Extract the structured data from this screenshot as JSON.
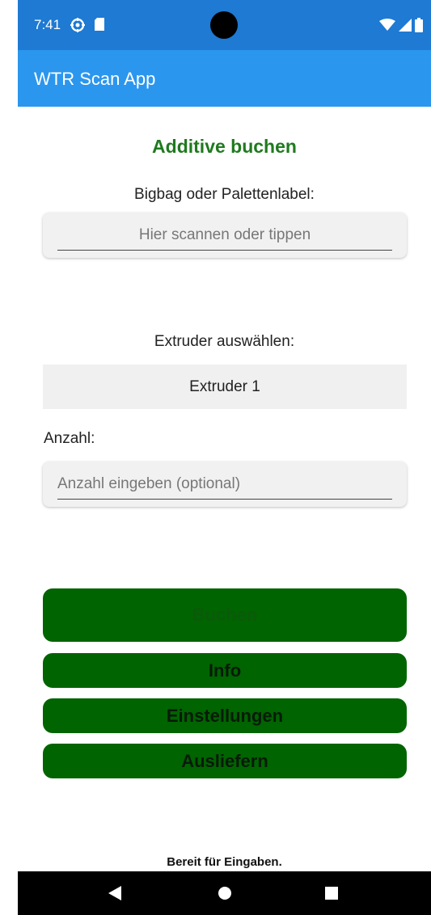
{
  "status_bar": {
    "time": "7:41",
    "left_icons": [
      "settings-icon",
      "sd-card-icon"
    ],
    "right_icons": [
      "wifi-icon",
      "signal-icon",
      "battery-icon"
    ]
  },
  "app_bar": {
    "title": "WTR Scan App"
  },
  "form": {
    "title": "Additive buchen",
    "label_input": "Bigbag oder Palettenlabel:",
    "scan_placeholder": "Hier scannen oder tippen",
    "scan_value": "",
    "extruder_label": "Extruder auswählen:",
    "extruder_selected": "Extruder 1",
    "anzahl_label": "Anzahl:",
    "anzahl_placeholder": "Anzahl eingeben (optional)",
    "anzahl_value": ""
  },
  "buttons": {
    "buchen": "Buchen",
    "info": "Info",
    "einstellungen": "Einstellungen",
    "ausliefern": "Ausliefern"
  },
  "status_text": "Bereit für Eingaben.",
  "colors": {
    "status_bar": "#1e7ad3",
    "app_bar": "#2b96ee",
    "title_green": "#1f7a1f",
    "button_green": "#006400"
  },
  "nav_bar": {
    "icons": [
      "back-icon",
      "home-icon",
      "recents-icon"
    ]
  }
}
